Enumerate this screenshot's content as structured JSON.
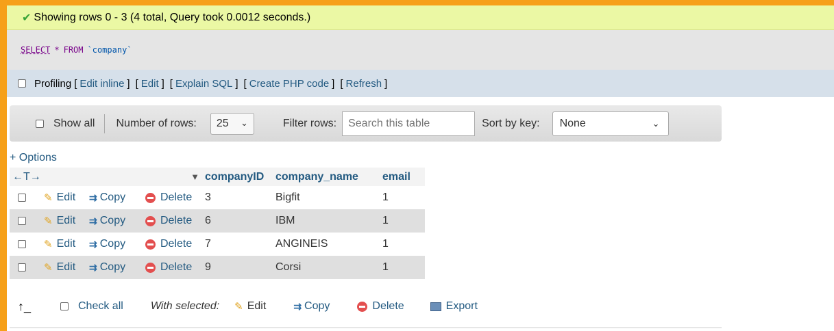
{
  "status": {
    "message": "Showing rows 0 - 3 (4 total, Query took 0.0012 seconds.)"
  },
  "sql": {
    "select": "SELECT",
    "star": "*",
    "from": "FROM",
    "table": "`company`"
  },
  "profiling": {
    "label": "Profiling",
    "links": [
      "Edit inline",
      "Edit",
      "Explain SQL",
      "Create PHP code",
      "Refresh"
    ]
  },
  "nav": {
    "show_all": "Show all",
    "rows_label": "Number of rows:",
    "rows_value": "25",
    "filter_label": "Filter rows:",
    "filter_placeholder": "Search this table",
    "sort_label": "Sort by key:",
    "sort_value": "None"
  },
  "options_link": "+ Options",
  "table": {
    "columns": [
      "companyID",
      "company_name",
      "email"
    ],
    "actions": {
      "edit": "Edit",
      "copy": "Copy",
      "delete": "Delete"
    },
    "rows": [
      {
        "companyID": "3",
        "company_name": "Bigfit",
        "email": "1"
      },
      {
        "companyID": "6",
        "company_name": "IBM",
        "email": "1"
      },
      {
        "companyID": "7",
        "company_name": "ANGINEIS",
        "email": "1"
      },
      {
        "companyID": "9",
        "company_name": "Corsi",
        "email": "1"
      }
    ]
  },
  "bulk": {
    "check_all": "Check all",
    "with_selected": "With selected:",
    "edit": "Edit",
    "copy": "Copy",
    "delete": "Delete",
    "export": "Export"
  },
  "colors": {
    "frame": "#f6a019",
    "success": "#ebf8a4",
    "link": "#235a81"
  }
}
